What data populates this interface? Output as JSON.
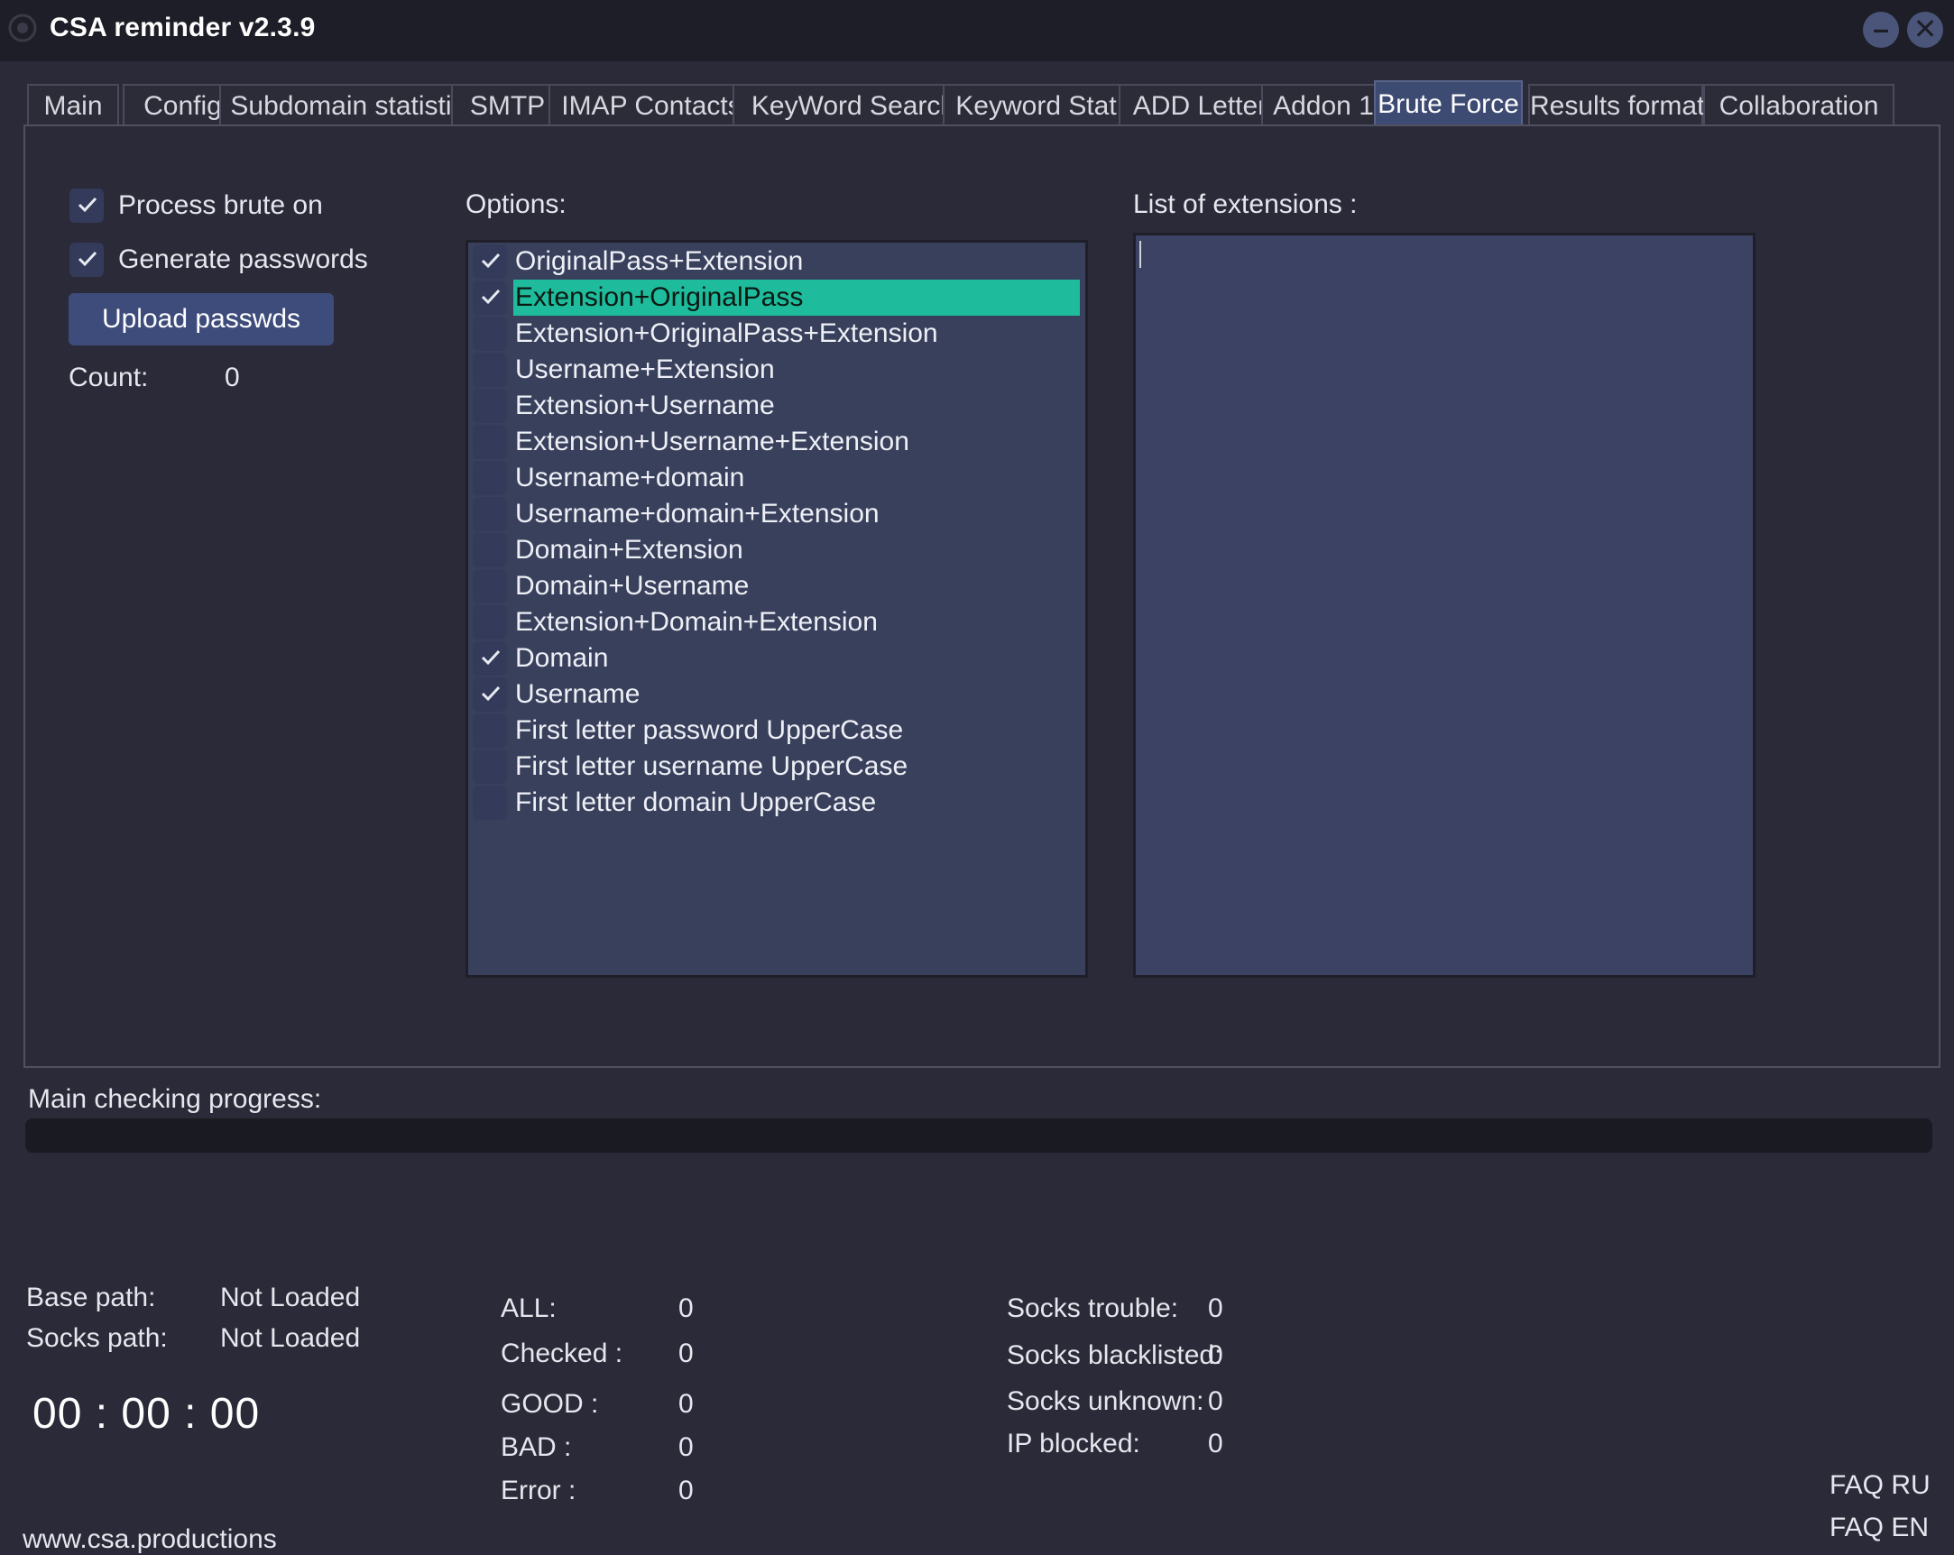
{
  "window": {
    "title": "CSA reminder v2.3.9"
  },
  "tabs": [
    {
      "label": "Main"
    },
    {
      "label": "Config"
    },
    {
      "label": "Subdomain statistic"
    },
    {
      "label": "SMTP"
    },
    {
      "label": "IMAP Contacts"
    },
    {
      "label": "KeyWord Search"
    },
    {
      "label": "Keyword Stat"
    },
    {
      "label": "ADD Letter"
    },
    {
      "label": "Addon 1"
    },
    {
      "label": "Brute Force",
      "active": true
    },
    {
      "label": "Results format"
    },
    {
      "label": "Collaboration"
    }
  ],
  "brute": {
    "process_brute_label": "Process brute on",
    "process_brute_checked": true,
    "generate_passwords_label": "Generate passwords",
    "generate_passwords_checked": true,
    "upload_button": "Upload passwds",
    "count_label": "Count:",
    "count_value": "0",
    "options_label": "Options:",
    "extensions_label": "List of extensions :",
    "extensions_value": ""
  },
  "options": [
    {
      "label": "OriginalPass+Extension",
      "checked": true
    },
    {
      "label": "Extension+OriginalPass",
      "checked": true,
      "selected": true
    },
    {
      "label": "Extension+OriginalPass+Extension",
      "checked": false
    },
    {
      "label": "Username+Extension",
      "checked": false
    },
    {
      "label": "Extension+Username",
      "checked": false
    },
    {
      "label": "Extension+Username+Extension",
      "checked": false
    },
    {
      "label": "Username+domain",
      "checked": false
    },
    {
      "label": "Username+domain+Extension",
      "checked": false
    },
    {
      "label": "Domain+Extension",
      "checked": false
    },
    {
      "label": "Domain+Username",
      "checked": false
    },
    {
      "label": "Extension+Domain+Extension",
      "checked": false
    },
    {
      "label": "Domain",
      "checked": true
    },
    {
      "label": "Username",
      "checked": true
    },
    {
      "label": "First letter password UpperCase",
      "checked": false
    },
    {
      "label": "First letter username UpperCase",
      "checked": false
    },
    {
      "label": "First letter domain UpperCase",
      "checked": false
    }
  ],
  "progress": {
    "label": "Main checking progress:",
    "value": 0
  },
  "status": {
    "base_path_label": "Base path:",
    "base_path_value": "Not Loaded",
    "socks_path_label": "Socks path:",
    "socks_path_value": "Not Loaded",
    "timer": "00 : 00 : 00",
    "all_label": "ALL:",
    "all_value": "0",
    "checked_label": "Checked :",
    "checked_value": "0",
    "good_label": "GOOD :",
    "good_value": "0",
    "bad_label": "BAD :",
    "bad_value": "0",
    "error_label": "Error :",
    "error_value": "0",
    "socks_trouble_label": "Socks trouble:",
    "socks_trouble_value": "0",
    "socks_blacklisted_label": "Socks blacklisted:",
    "socks_blacklisted_value": "0",
    "socks_unknown_label": "Socks unknown:",
    "socks_unknown_value": "0",
    "ip_blocked_label": "IP blocked:",
    "ip_blocked_value": "0"
  },
  "footer": {
    "site_link": "www.csa.productions",
    "faq_ru": "FAQ RU",
    "faq_en": "FAQ EN"
  },
  "colors": {
    "background": "#2a2a38",
    "titlebar": "#1e1e28",
    "accent_selected": "#1ebc9c",
    "active_tab": "#3d4a72",
    "button": "#3e4c7c",
    "list_bg": "#39405c"
  }
}
